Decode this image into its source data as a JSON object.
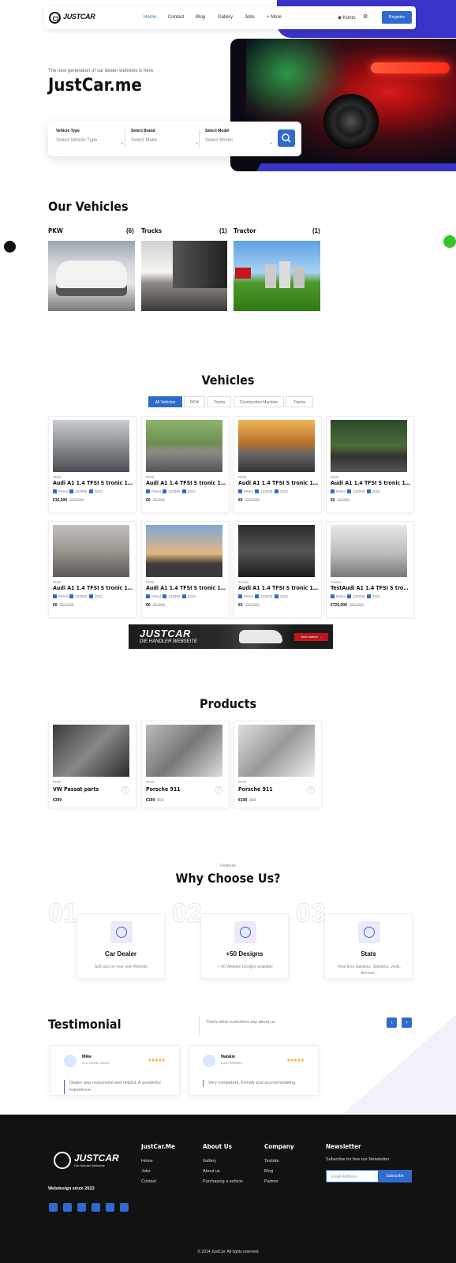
{
  "nav": {
    "logo": "JUSTCAR",
    "items": [
      "Home",
      "Contact",
      "Blog",
      "Gallery",
      "Jobs",
      "+ More"
    ],
    "account": "Konto",
    "register": "Register"
  },
  "hero": {
    "tagline": "The next generation of car dealer websites is here.",
    "title": "JustCar.me",
    "search": {
      "fields": [
        {
          "label": "Vehicle Type",
          "placeholder": "Select Vehicle Type"
        },
        {
          "label": "Select Brand",
          "placeholder": "Select Make"
        },
        {
          "label": "Select Model",
          "placeholder": "Select Model"
        }
      ]
    }
  },
  "our_vehicles": {
    "title": "Our Vehicles",
    "categories": [
      {
        "name": "PKW",
        "count": "(6)"
      },
      {
        "name": "Trucks",
        "count": "(1)"
      },
      {
        "name": "Tractor",
        "count": "(1)"
      }
    ]
  },
  "vehicles": {
    "title": "Vehicles",
    "tabs": [
      "All Vehicles",
      "PKW",
      "Trucks",
      "Construction Machine",
      "Tractor"
    ],
    "cards": [
      {
        "cat": "PKW",
        "name": "Audi A1 1.4 TFSI S tronic 185PS...",
        "fuel": "Petrol",
        "km": "122000",
        "year": "2022",
        "price": "€15,000",
        "old": "€17,000"
      },
      {
        "cat": "PKW",
        "name": "Audi A1 1.4 TFSI S tronic 185PS...",
        "fuel": "Petrol",
        "km": "122000",
        "year": "2022",
        "price": "€0",
        "old": "€1,000"
      },
      {
        "cat": "PKW",
        "name": "Audi A1 1.4 TFSI S tronic 185PS...",
        "fuel": "Petrol",
        "km": "122000",
        "year": "2022",
        "price": "€0",
        "old": "€17,000"
      },
      {
        "cat": "PKW",
        "name": "Audi A1 1.4 TFSI S tronic 185PS...",
        "fuel": "Petrol",
        "km": "122000",
        "year": "2022",
        "price": "€0",
        "old": "€1,000"
      },
      {
        "cat": "PKW",
        "name": "Audi A1 1.4 TFSI S tronic 185PS...",
        "fuel": "Petrol",
        "km": "122000",
        "year": "2022",
        "price": "€0",
        "old": "€17,000"
      },
      {
        "cat": "PKW",
        "name": "Audi A1 1.4 TFSI S tronic 185PS...",
        "fuel": "Petrol",
        "km": "122000",
        "year": "2022",
        "price": "€0",
        "old": "€1,000"
      },
      {
        "cat": "Trucks",
        "name": "Audi A1 1.4 TFSI S tronic 185PS...",
        "fuel": "Petrol",
        "km": "122000",
        "year": "2022",
        "price": "€0",
        "old": "€17,000"
      },
      {
        "cat": "Tractor",
        "name": "TestAudi A1 1.4 TFSI S tronic...",
        "fuel": "Petrol",
        "km": "122000",
        "year": "2022",
        "price": "€725,000",
        "old": "€10,000"
      }
    ]
  },
  "banner": {
    "title": "JUSTCAR",
    "subtitle": "DIE HÄNDLER WEBSEITE",
    "cta": "Jetzt starten →"
  },
  "products": {
    "title": "Products",
    "items": [
      {
        "cat": "PKW",
        "name": "VW Passat parts",
        "price": "€399",
        "old": ""
      },
      {
        "cat": "PKW",
        "name": "Porsche 911",
        "price": "€199",
        "old": "€59"
      },
      {
        "cat": "PKW",
        "name": "Porsche 911",
        "price": "€199",
        "old": "€59"
      }
    ]
  },
  "why": {
    "eyebrow": "Features",
    "title": "Why Choose Us?",
    "items": [
      {
        "num": "01",
        "title": "Car Dealer",
        "desc": "Sell cars on your own Website."
      },
      {
        "num": "02",
        "title": "+50 Designs",
        "desc": "+ 50 Website Designs available"
      },
      {
        "num": "03",
        "title": "Stats",
        "desc": "Real time statistics. Statistics, visits, devices..."
      }
    ]
  },
  "testimonial": {
    "title": "Testimonial",
    "subtitle": "That's what customers say about us.",
    "items": [
      {
        "name": "Mike",
        "role": "Car Dealer owner",
        "stars": "★★★★★",
        "quote": "Dealer was responsive and helpful. A wonderful experience."
      },
      {
        "name": "Natalie",
        "role": "Cars Website",
        "stars": "★★★★★",
        "quote": "Very competent, friendly and accommodating."
      }
    ]
  },
  "footer": {
    "logo": "JUSTCAR",
    "logo_sub": "Die Händler Webseite",
    "since": "Webdesign since 2023",
    "cols": [
      {
        "title": "JustCar.Me",
        "links": [
          "Home",
          "Jobs",
          "Contact"
        ]
      },
      {
        "title": "About Us",
        "links": [
          "Gallery",
          "About us",
          "Purchasing a vehicle"
        ]
      },
      {
        "title": "Company",
        "links": [
          "Testsite",
          "Blog",
          "Partner"
        ]
      }
    ],
    "newsletter": {
      "title": "Newsletter",
      "text": "Subscribe for free our Newsletter",
      "placeholder": "Email Address",
      "button": "Subscribe"
    },
    "copyright": "© 2024 JustCar. All rights reserved"
  }
}
